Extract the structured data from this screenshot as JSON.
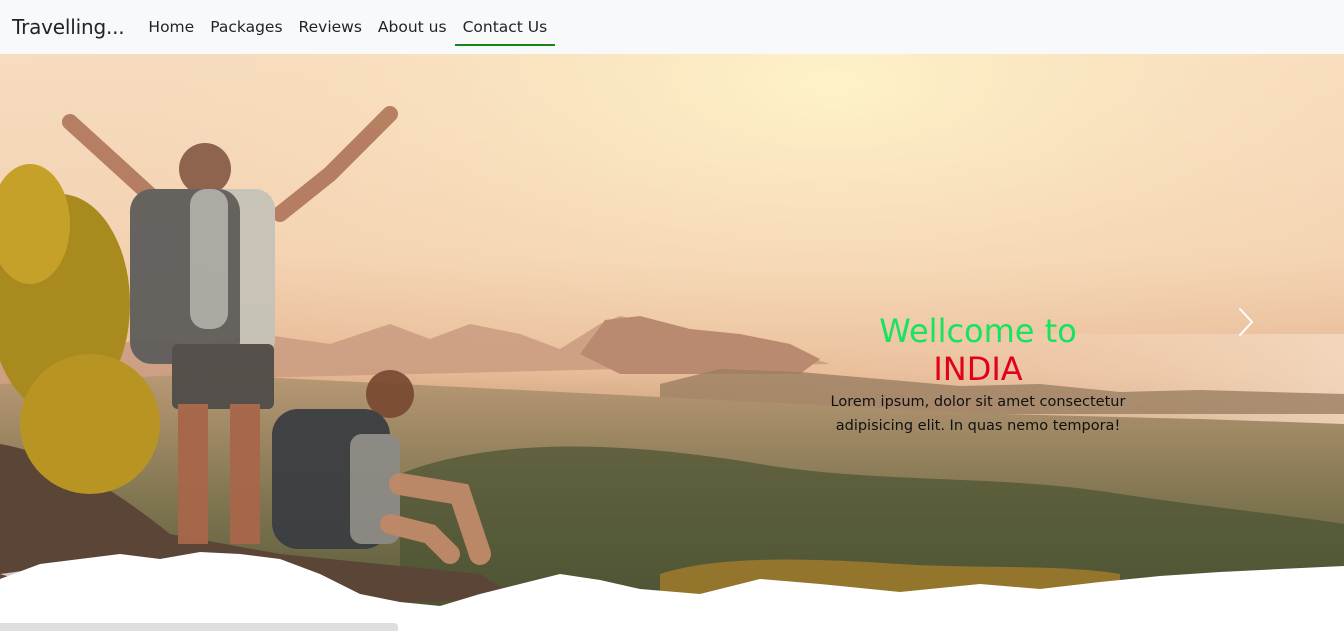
{
  "navbar": {
    "brand": "Travelling...",
    "items": [
      {
        "label": "Home"
      },
      {
        "label": "Packages"
      },
      {
        "label": "Reviews"
      },
      {
        "label": "About us"
      },
      {
        "label": "Contact Us",
        "active": true
      }
    ]
  },
  "carousel": {
    "caption": {
      "title": "Wellcome to",
      "subtitle": "INDIA",
      "text_line1": "Lorem ipsum, dolor sit amet consectetur",
      "text_line2": "adipisicing elit. In quas nemo tempora!"
    },
    "next_icon": "chevron-right-icon"
  },
  "colors": {
    "title": "#16e35f",
    "subtitle": "#e3001b",
    "active_underline": "#198219",
    "navbar_bg": "#f8f9fa"
  }
}
